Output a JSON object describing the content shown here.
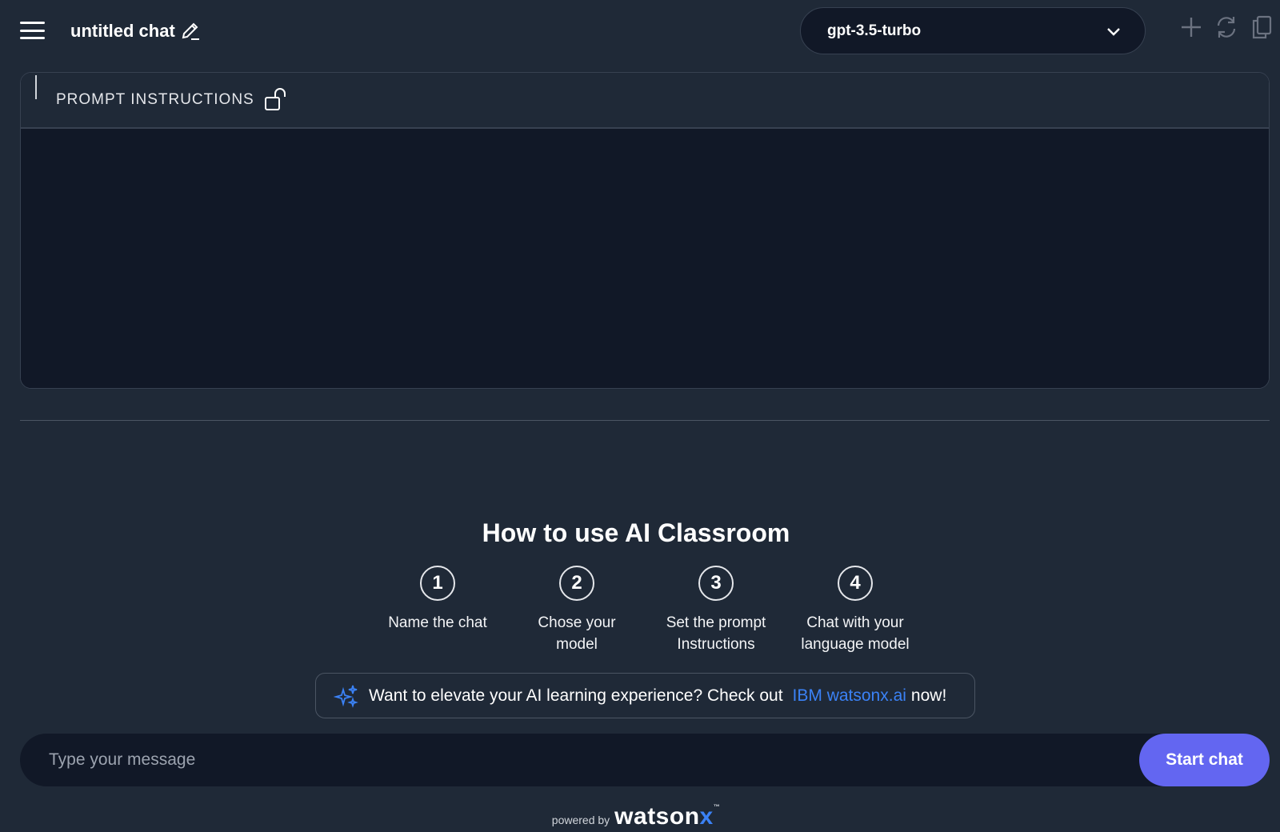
{
  "header": {
    "chat_title": "untitled chat",
    "model": "gpt-3.5-turbo"
  },
  "prompt": {
    "title": "PROMPT INSTRUCTIONS",
    "value": ""
  },
  "howto": {
    "title": "How to use AI Classroom",
    "steps": [
      {
        "num": "1",
        "text": "Name the chat"
      },
      {
        "num": "2",
        "text": "Chose your model"
      },
      {
        "num": "3",
        "text": "Set the prompt Instructions"
      },
      {
        "num": "4",
        "text": "Chat with your language model"
      }
    ]
  },
  "promo": {
    "text_before": "Want to elevate your AI learning experience? Check out",
    "link": "IBM watsonx.ai",
    "text_after": "now!"
  },
  "composer": {
    "placeholder": "Type your message",
    "button": "Start chat"
  },
  "footer": {
    "powered_by": "powered by",
    "brand_main": "watson",
    "brand_x": "x",
    "tm": "™"
  },
  "colors": {
    "background": "#1f2937",
    "panel": "#111827",
    "accent_button": "#6366f1",
    "link": "#3b82f6"
  }
}
